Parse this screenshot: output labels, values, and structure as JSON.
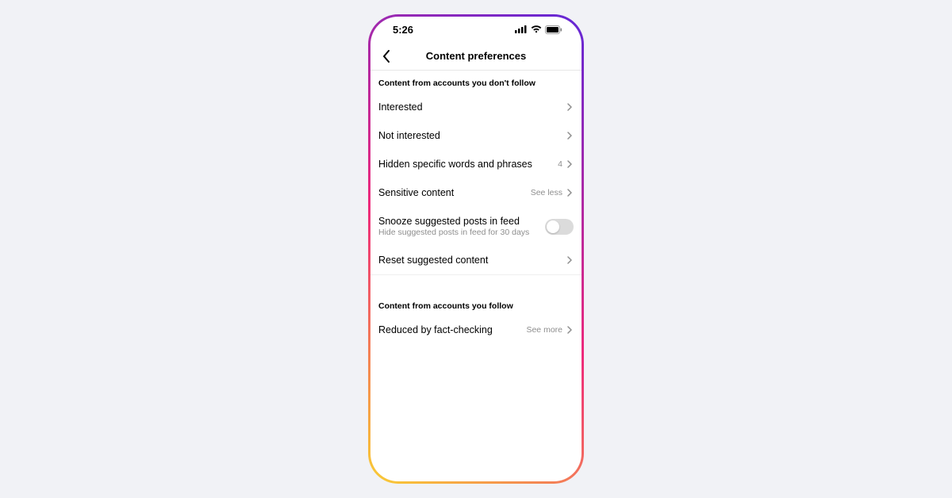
{
  "status": {
    "time": "5:26"
  },
  "nav": {
    "title": "Content preferences"
  },
  "section1": {
    "header": "Content from accounts you don't follow",
    "rows": {
      "interested": {
        "label": "Interested"
      },
      "not_interested": {
        "label": "Not interested"
      },
      "hidden_words": {
        "label": "Hidden specific words and phrases",
        "value": "4"
      },
      "sensitive": {
        "label": "Sensitive content",
        "value": "See less"
      },
      "snooze": {
        "label": "Snooze suggested posts in feed",
        "sub": "Hide suggested posts in feed for 30 days"
      },
      "reset": {
        "label": "Reset suggested content"
      }
    }
  },
  "section2": {
    "header": "Content from accounts you follow",
    "rows": {
      "fact_check": {
        "label": "Reduced by fact-checking",
        "value": "See more"
      }
    }
  }
}
